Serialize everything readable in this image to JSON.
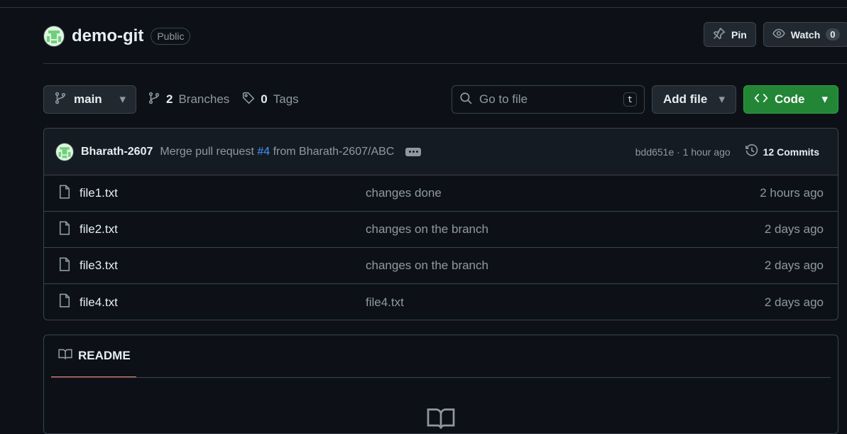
{
  "repo": {
    "name": "demo-git",
    "visibility": "Public",
    "pin_label": "Pin",
    "watch_label": "Watch",
    "watch_count": "0"
  },
  "toolbar": {
    "branch": "main",
    "branches_count": "2",
    "branches_label": "Branches",
    "tags_count": "0",
    "tags_label": "Tags",
    "goto_placeholder": "Go to file",
    "goto_shortcut": "t",
    "add_file_label": "Add file",
    "code_label": "Code"
  },
  "commit": {
    "author": "Bharath-2607",
    "message_prefix": "Merge pull request",
    "pr": "#4",
    "message_suffix": "from Bharath-2607/ABC",
    "hash_time": "bdd651e · 1 hour ago",
    "commits_label": "12 Commits"
  },
  "files": [
    {
      "name": "file1.txt",
      "message": "changes done",
      "time": "2 hours ago"
    },
    {
      "name": "file2.txt",
      "message": "changes on the branch",
      "time": "2 days ago"
    },
    {
      "name": "file3.txt",
      "message": "changes on the branch",
      "time": "2 days ago"
    },
    {
      "name": "file4.txt",
      "message": "file4.txt",
      "time": "2 days ago"
    }
  ],
  "readme": {
    "tab_label": "README"
  },
  "icons": [
    "avatar",
    "pin-icon",
    "eye-icon",
    "branch-icon",
    "tag-icon",
    "search-icon",
    "code-icon",
    "history-icon",
    "file-icon",
    "book-icon",
    "ellipsis-icon"
  ],
  "colors": {
    "background": "#0d1117",
    "border": "#3d444d",
    "accent_green": "#238636",
    "link_blue": "#4493f8",
    "tab_underline": "#f78166"
  }
}
